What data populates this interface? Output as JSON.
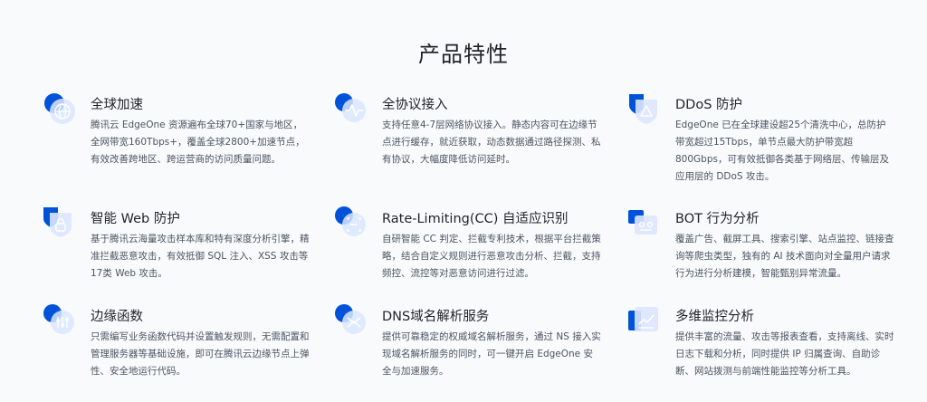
{
  "section": {
    "title": "产品特性"
  },
  "colors": {
    "accent": "#0052d9",
    "accent_light": "#c7d9ff",
    "text": "#1f2329",
    "muted": "#4b5563"
  },
  "features": [
    {
      "icon": "globe-icon",
      "title": "全球加速",
      "desc": "腾讯云 EdgeOne 资源遍布全球70+国家与地区，全网带宽160Tbps+，覆盖全球2800+加速节点，有效改善跨地区、跨运营商的访问质量问题。"
    },
    {
      "icon": "protocol-pulse-icon",
      "title": "全协议接入",
      "desc": "支持任意4-7层网络协议接入。静态内容可在边缘节点进行缓存，就近获取，动态数据通过路径探测、私有协议，大幅度降低访问延时。"
    },
    {
      "icon": "ddos-shield-icon",
      "title": "DDoS 防护",
      "desc": "EdgeOne 已在全球建设超25个清洗中心，总防护带宽超过15Tbps，单节点最大防护带宽超800Gbps，可有效抵御各类基于网络层、传输层及应用层的 DDoS 攻击。"
    },
    {
      "icon": "web-lock-shield-icon",
      "title": "智能 Web 防护",
      "desc": "基于腾讯云海量攻击样本库和特有深度分析引擎，精准拦截恶意攻击，有效抵御 SQL 注入、XSS 攻击等17类 Web 攻击。"
    },
    {
      "icon": "rate-limit-scan-icon",
      "title": "Rate-Limiting(CC) 自适应识别",
      "desc": "自研智能 CC 判定、拦截专利技术，根据平台拦截策略，结合自定义规则进行恶意攻击分析、拦截，支持频控、流控等对恶意访问进行过滤。"
    },
    {
      "icon": "bot-analysis-icon",
      "title": "BOT 行为分析",
      "desc": "覆盖广告、截屏工具、搜索引擎、站点监控、链接查询等爬虫类型，独有的 AI 技术面向对全量用户请求行为进行分析建模，智能甄别异常流量。"
    },
    {
      "icon": "edge-function-icon",
      "title": "边缘函数",
      "desc": "只需编写业务函数代码并设置触发规则，无需配置和管理服务器等基础设施，即可在腾讯云边缘节点上弹性、安全地运行代码。"
    },
    {
      "icon": "dns-icon",
      "title": "DNS域名解析服务",
      "desc": "提供可靠稳定的权威域名解析服务，通过 NS 接入实现域名解析服务的同时，可一键开启 EdgeOne 安全与加速服务。"
    },
    {
      "icon": "monitor-chart-icon",
      "title": "多维监控分析",
      "desc": "提供丰富的流量、攻击等报表查看，支持离线、实时日志下载和分析，同时提供 IP 归属查询、自助诊断、网站拨测与前端性能监控等分析工具。"
    }
  ]
}
